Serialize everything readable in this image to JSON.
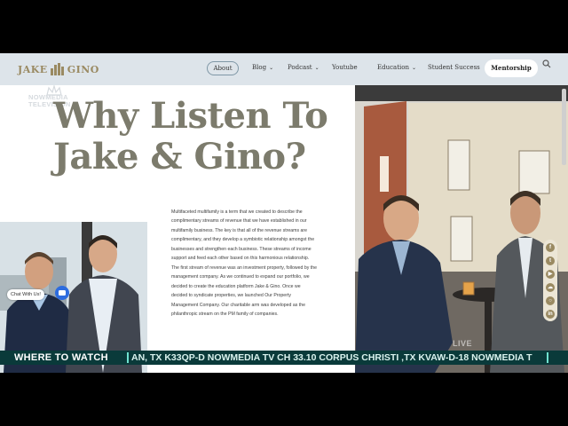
{
  "brand": {
    "logo_left": "JAKE",
    "logo_right": "GINO"
  },
  "nav": {
    "items": [
      {
        "label": "About",
        "dropdown": false
      },
      {
        "label": "Blog",
        "dropdown": true
      },
      {
        "label": "Podcast",
        "dropdown": true
      },
      {
        "label": "Youtube",
        "dropdown": false
      },
      {
        "label": "Education",
        "dropdown": true
      },
      {
        "label": "Student Success",
        "dropdown": false
      }
    ],
    "cta": "Mentorship",
    "search_icon": "search-icon"
  },
  "watermark": {
    "line1": "NOWMEDIA",
    "line2": "TELEVISION"
  },
  "hero": {
    "headline_line1": "Why Listen To",
    "headline_line2": "Jake & Gino?"
  },
  "body": {
    "paragraph": "Multifaceted multifamily is a term that we created to describe the complimentary streams of revenue that we have established in our multifamily business. The key is that all of the revenue streams are complimentary, and they develop a symbiotic relationship amongst the businesses and strengthen each business. These streams of income support and feed each other based on this harmonious relationship. The first stream of revenue was an investment property, followed by the management company. As we continued to expand our portfolio, we decided to create the education platform Jake & Gino. Once we decided to syndicate properties, we launched Our Property Management Company. Our charitable arm was developed as the philanthropic stream on the PM family of companies."
  },
  "social": [
    "facebook-icon",
    "twitter-icon",
    "youtube-icon",
    "soundcloud-icon",
    "instagram-icon",
    "linkedin-icon"
  ],
  "chat": {
    "label": "Chat With Us!"
  },
  "ticker": {
    "label": "WHERE TO WATCH",
    "text": "AN, TX  K33QP-D NOWMEDIA TV CH 33.10 CORPUS CHRISTI ,TX  KVAW-D-18 NOWMEDIA T"
  },
  "live_bug": "LIVE",
  "colors": {
    "nav_bg": "#dde4ea",
    "brand_gold": "#9a8a62",
    "headline": "#7c7b6c",
    "ticker_bg": "#0a3a3a",
    "ticker_accent": "#6fe2cf"
  }
}
